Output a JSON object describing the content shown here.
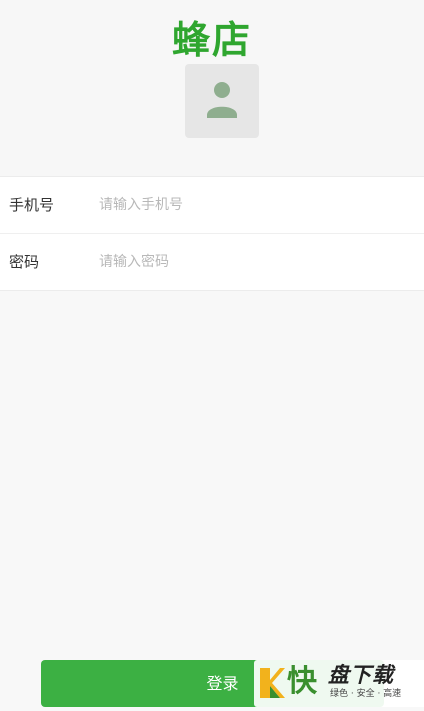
{
  "app": {
    "title": "蜂店"
  },
  "form": {
    "phone": {
      "label": "手机号",
      "placeholder": "请输入手机号",
      "value": ""
    },
    "password": {
      "label": "密码",
      "placeholder": "请输入密码",
      "value": ""
    }
  },
  "actions": {
    "login_label": "登录"
  },
  "watermark": {
    "brand": "快",
    "name": "盘下载",
    "tagline": "绿色 · 安全 · 高速"
  },
  "colors": {
    "brand_green": "#2fa62f",
    "button_green": "#3cb043",
    "background": "#f8f8f8"
  },
  "icons": {
    "avatar": "user-avatar-icon"
  }
}
